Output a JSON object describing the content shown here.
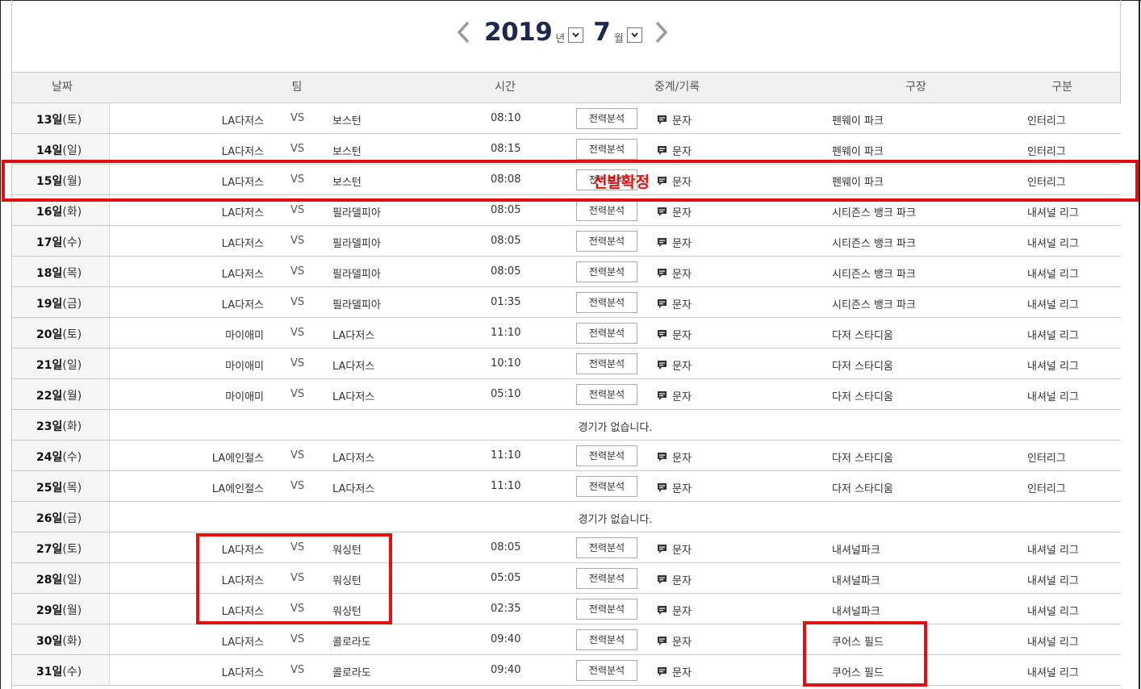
{
  "nav": {
    "year": "2019",
    "year_unit": "년",
    "month": "7",
    "month_unit": "월"
  },
  "columns": {
    "date": "날짜",
    "team": "팀",
    "time": "시간",
    "broadcast": "중계/기록",
    "stadium": "구장",
    "category": "구분"
  },
  "labels": {
    "vs": "VS",
    "analysis": "전력분석",
    "text": "문자",
    "no_game": "경기가 없습니다."
  },
  "annotation_text": "선발확정",
  "games": [
    {
      "day": "13일",
      "weekday": "(토)",
      "home": "LA다저스",
      "away": "보스턴",
      "time": "08:10",
      "stadium": "펜웨이 파크",
      "category": "인터리그"
    },
    {
      "day": "14일",
      "weekday": "(일)",
      "home": "LA다저스",
      "away": "보스턴",
      "time": "08:15",
      "stadium": "펜웨이 파크",
      "category": "인터리그"
    },
    {
      "day": "15일",
      "weekday": "(월)",
      "home": "LA다저스",
      "away": "보스턴",
      "time": "08:08",
      "stadium": "펜웨이 파크",
      "category": "인터리그"
    },
    {
      "day": "16일",
      "weekday": "(화)",
      "home": "LA다저스",
      "away": "필라델피아",
      "time": "08:05",
      "stadium": "시티즌스 뱅크 파크",
      "category": "내셔널 리그"
    },
    {
      "day": "17일",
      "weekday": "(수)",
      "home": "LA다저스",
      "away": "필라델피아",
      "time": "08:05",
      "stadium": "시티즌스 뱅크 파크",
      "category": "내셔널 리그"
    },
    {
      "day": "18일",
      "weekday": "(목)",
      "home": "LA다저스",
      "away": "필라델피아",
      "time": "08:05",
      "stadium": "시티즌스 뱅크 파크",
      "category": "내셔널 리그"
    },
    {
      "day": "19일",
      "weekday": "(금)",
      "home": "LA다저스",
      "away": "필라델피아",
      "time": "01:35",
      "stadium": "시티즌스 뱅크 파크",
      "category": "내셔널 리그"
    },
    {
      "day": "20일",
      "weekday": "(토)",
      "home": "마이애미",
      "away": "LA다저스",
      "time": "11:10",
      "stadium": "다저 스타디움",
      "category": "내셔널 리그"
    },
    {
      "day": "21일",
      "weekday": "(일)",
      "home": "마이애미",
      "away": "LA다저스",
      "time": "10:10",
      "stadium": "다저 스타디움",
      "category": "내셔널 리그"
    },
    {
      "day": "22일",
      "weekday": "(월)",
      "home": "마이애미",
      "away": "LA다저스",
      "time": "05:10",
      "stadium": "다저 스타디움",
      "category": "내셔널 리그"
    },
    {
      "day": "23일",
      "weekday": "(화)",
      "no_game": true
    },
    {
      "day": "24일",
      "weekday": "(수)",
      "home": "LA에인절스",
      "away": "LA다저스",
      "time": "11:10",
      "stadium": "다저 스타디움",
      "category": "인터리그"
    },
    {
      "day": "25일",
      "weekday": "(목)",
      "home": "LA에인절스",
      "away": "LA다저스",
      "time": "11:10",
      "stadium": "다저 스타디움",
      "category": "인터리그"
    },
    {
      "day": "26일",
      "weekday": "(금)",
      "no_game": true
    },
    {
      "day": "27일",
      "weekday": "(토)",
      "home": "LA다저스",
      "away": "워싱턴",
      "time": "08:05",
      "stadium": "내셔널파크",
      "category": "내셔널 리그"
    },
    {
      "day": "28일",
      "weekday": "(일)",
      "home": "LA다저스",
      "away": "워싱턴",
      "time": "05:05",
      "stadium": "내셔널파크",
      "category": "내셔널 리그"
    },
    {
      "day": "29일",
      "weekday": "(월)",
      "home": "LA다저스",
      "away": "워싱턴",
      "time": "02:35",
      "stadium": "내셔널파크",
      "category": "내셔널 리그"
    },
    {
      "day": "30일",
      "weekday": "(화)",
      "home": "LA다저스",
      "away": "콜로라도",
      "time": "09:40",
      "stadium": "쿠어스 필드",
      "category": "내셔널 리그"
    },
    {
      "day": "31일",
      "weekday": "(수)",
      "home": "LA다저스",
      "away": "콜로라도",
      "time": "09:40",
      "stadium": "쿠어스 필드",
      "category": "내셔널 리그"
    }
  ]
}
